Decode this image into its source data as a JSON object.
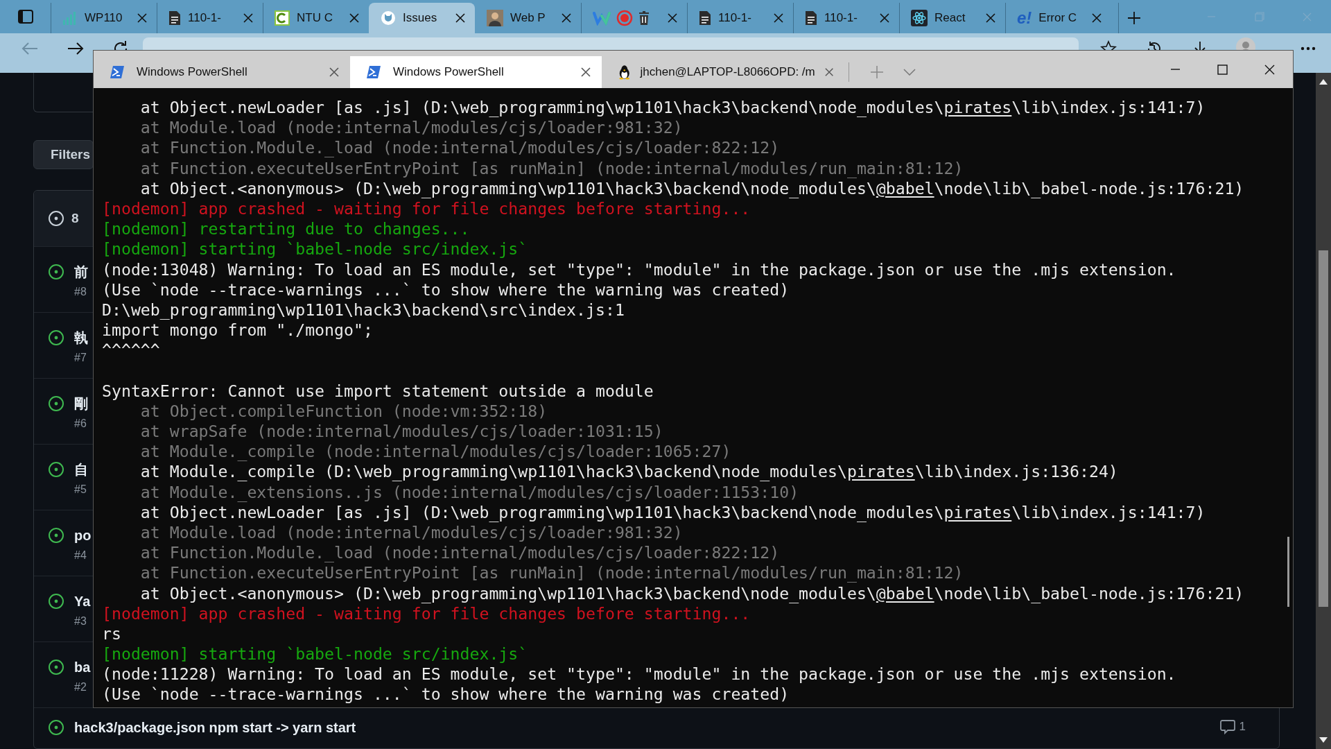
{
  "browser": {
    "tabs": [
      {
        "kind": "chart",
        "title": "WP110",
        "selected": false
      },
      {
        "kind": "doc",
        "title": "110-1-",
        "selected": false
      },
      {
        "kind": "ntu",
        "title": "NTU C",
        "selected": false
      },
      {
        "kind": "github",
        "title": "Issues",
        "selected": true
      },
      {
        "kind": "photo",
        "title": "Web P",
        "selected": false
      },
      {
        "kind": "group",
        "selected": false
      },
      {
        "kind": "doc",
        "title": "110-1-",
        "selected": false
      },
      {
        "kind": "doc",
        "title": "110-1-",
        "selected": false
      },
      {
        "kind": "react",
        "title": "React",
        "selected": false
      },
      {
        "kind": "logo",
        "logo_text": "e!",
        "title": "Error C",
        "selected": false
      }
    ]
  },
  "issues": {
    "filters_button": "Filters",
    "open_count": "8",
    "rows": [
      {
        "title": "前",
        "number": "#8"
      },
      {
        "title": "執",
        "number": "#7"
      },
      {
        "title": "剛",
        "number": "#6"
      },
      {
        "title": "自",
        "number": "#5"
      },
      {
        "title": "po",
        "number": "#4"
      },
      {
        "title": "Ya",
        "number": "#3"
      },
      {
        "title": "ba",
        "number": "#2"
      }
    ],
    "last_row": {
      "title": "hack3/package.json npm start -> yarn start",
      "comments": "1"
    }
  },
  "terminal": {
    "tabs": [
      {
        "kind": "powershell",
        "title": "Windows PowerShell",
        "selected": false
      },
      {
        "kind": "powershell",
        "title": "Windows PowerShell",
        "selected": true
      },
      {
        "kind": "linux",
        "title": "jhchen@LAPTOP-L8066OPD: /m",
        "selected": false
      }
    ],
    "lines": [
      {
        "kind": "text",
        "parts": [
          {
            "text": "    at Object.newLoader [as .js] (D:\\web_programming\\wp1101\\hack3\\backend\\node_modules\\",
            "underline": false
          },
          {
            "text": "pirates",
            "underline": true
          },
          {
            "text": "\\lib\\index.js:141:7)",
            "underline": false
          }
        ]
      },
      {
        "kind": "dim",
        "text": "    at Module.load (node:internal/modules/cjs/loader:981:32)"
      },
      {
        "kind": "dim",
        "text": "    at Function.Module._load (node:internal/modules/cjs/loader:822:12)"
      },
      {
        "kind": "dim",
        "text": "    at Function.executeUserEntryPoint [as runMain] (node:internal/modules/run_main:81:12)"
      },
      {
        "kind": "text",
        "parts": [
          {
            "text": "    at Object.<anonymous> (D:\\web_programming\\wp1101\\hack3\\backend\\node_modules\\",
            "underline": false
          },
          {
            "text": "@babel",
            "underline": true
          },
          {
            "text": "\\node\\lib\\_babel-node.js:176:21)",
            "underline": false
          }
        ]
      },
      {
        "kind": "error",
        "text": "[nodemon] app crashed - waiting for file changes before starting..."
      },
      {
        "kind": "success",
        "text": "[nodemon] restarting due to changes..."
      },
      {
        "kind": "success",
        "text": "[nodemon] starting `babel-node src/index.js`"
      },
      {
        "kind": "text",
        "text": "(node:13048) Warning: To load an ES module, set \"type\": \"module\" in the package.json or use the .mjs extension."
      },
      {
        "kind": "text",
        "text": "(Use `node --trace-warnings ...` to show where the warning was created)"
      },
      {
        "kind": "text",
        "text": "D:\\web_programming\\wp1101\\hack3\\backend\\src\\index.js:1"
      },
      {
        "kind": "text",
        "text": "import mongo from \"./mongo\";"
      },
      {
        "kind": "text",
        "text": "^^^^^^"
      },
      {
        "kind": "blank"
      },
      {
        "kind": "text",
        "text": "SyntaxError: Cannot use import statement outside a module"
      },
      {
        "kind": "dim",
        "text": "    at Object.compileFunction (node:vm:352:18)"
      },
      {
        "kind": "dim",
        "text": "    at wrapSafe (node:internal/modules/cjs/loader:1031:15)"
      },
      {
        "kind": "dim",
        "text": "    at Module._compile (node:internal/modules/cjs/loader:1065:27)"
      },
      {
        "kind": "text",
        "parts": [
          {
            "text": "    at Module._compile (D:\\web_programming\\wp1101\\hack3\\backend\\node_modules\\",
            "underline": false
          },
          {
            "text": "pirates",
            "underline": true
          },
          {
            "text": "\\lib\\index.js:136:24)",
            "underline": false
          }
        ]
      },
      {
        "kind": "dim",
        "text": "    at Module._extensions..js (node:internal/modules/cjs/loader:1153:10)"
      },
      {
        "kind": "text",
        "parts": [
          {
            "text": "    at Object.newLoader [as .js] (D:\\web_programming\\wp1101\\hack3\\backend\\node_modules\\",
            "underline": false
          },
          {
            "text": "pirates",
            "underline": true
          },
          {
            "text": "\\lib\\index.js:141:7)",
            "underline": false
          }
        ]
      },
      {
        "kind": "dim",
        "text": "    at Module.load (node:internal/modules/cjs/loader:981:32)"
      },
      {
        "kind": "dim",
        "text": "    at Function.Module._load (node:internal/modules/cjs/loader:822:12)"
      },
      {
        "kind": "dim",
        "text": "    at Function.executeUserEntryPoint [as runMain] (node:internal/modules/run_main:81:12)"
      },
      {
        "kind": "text",
        "parts": [
          {
            "text": "    at Object.<anonymous> (D:\\web_programming\\wp1101\\hack3\\backend\\node_modules\\",
            "underline": false
          },
          {
            "text": "@babel",
            "underline": true
          },
          {
            "text": "\\node\\lib\\_babel-node.js:176:21)",
            "underline": false
          }
        ]
      },
      {
        "kind": "error",
        "text": "[nodemon] app crashed - waiting for file changes before starting..."
      },
      {
        "kind": "text",
        "text": "rs"
      },
      {
        "kind": "success",
        "text": "[nodemon] starting `babel-node src/index.js`"
      },
      {
        "kind": "text",
        "text": "(node:11228) Warning: To load an ES module, set \"type\": \"module\" in the package.json or use the .mjs extension."
      },
      {
        "kind": "text",
        "text": "(Use `node --trace-warnings ...` to show where the warning was created)"
      }
    ]
  }
}
